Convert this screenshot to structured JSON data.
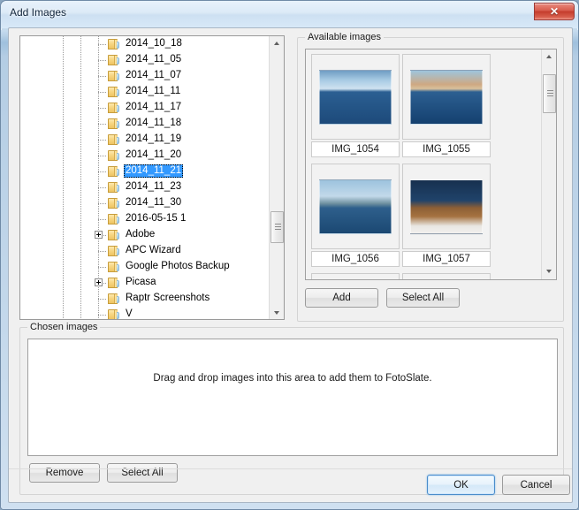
{
  "window": {
    "title": "Add Images",
    "close_label": "✕",
    "close_icon": "close-icon"
  },
  "tree": {
    "items": [
      {
        "label": "2014_10_18",
        "expandable": false,
        "selected": false,
        "partial": false
      },
      {
        "label": "2014_11_05",
        "expandable": false,
        "selected": false,
        "partial": false
      },
      {
        "label": "2014_11_07",
        "expandable": false,
        "selected": false,
        "partial": false
      },
      {
        "label": "2014_11_11",
        "expandable": false,
        "selected": false,
        "partial": false
      },
      {
        "label": "2014_11_17",
        "expandable": false,
        "selected": false,
        "partial": false
      },
      {
        "label": "2014_11_18",
        "expandable": false,
        "selected": false,
        "partial": false
      },
      {
        "label": "2014_11_19",
        "expandable": false,
        "selected": false,
        "partial": false
      },
      {
        "label": "2014_11_20",
        "expandable": false,
        "selected": false,
        "partial": false
      },
      {
        "label": "2014_11_21",
        "expandable": false,
        "selected": true,
        "partial": false
      },
      {
        "label": "2014_11_23",
        "expandable": false,
        "selected": false,
        "partial": false
      },
      {
        "label": "2014_11_30",
        "expandable": false,
        "selected": false,
        "partial": false
      },
      {
        "label": "2016-05-15 1",
        "expandable": false,
        "selected": false,
        "partial": false
      },
      {
        "label": "Adobe",
        "expandable": true,
        "selected": false,
        "partial": false
      },
      {
        "label": "APC Wizard",
        "expandable": false,
        "selected": false,
        "partial": false
      },
      {
        "label": "Google Photos Backup",
        "expandable": false,
        "selected": false,
        "partial": false
      },
      {
        "label": "Picasa",
        "expandable": true,
        "selected": false,
        "partial": false
      },
      {
        "label": "Raptr Screenshots",
        "expandable": false,
        "selected": false,
        "partial": false
      },
      {
        "label": "V",
        "expandable": false,
        "selected": false,
        "partial": true
      }
    ],
    "scroll_thumb_top_pct": 72
  },
  "available": {
    "legend": "Available images",
    "thumbnails": [
      {
        "name": "IMG_1054",
        "art": "ph-1054"
      },
      {
        "name": "IMG_1055",
        "art": "ph-1055"
      },
      {
        "name": "IMG_1056",
        "art": "ph-1056"
      },
      {
        "name": "IMG_1057",
        "art": "ph-1057"
      }
    ],
    "add_label": "Add",
    "select_all_label": "Select All",
    "scroll_thumb_top_pct": 6
  },
  "chosen": {
    "legend": "Chosen images",
    "hint": "Drag and drop images into this area to add them to FotoSlate.",
    "remove_label": "Remove",
    "select_all_label": "Select All"
  },
  "footer": {
    "ok_label": "OK",
    "cancel_label": "Cancel"
  },
  "colors": {
    "selection_blue": "#3399ff",
    "close_red": "#c43c2c",
    "default_button_border": "#4b8dcb"
  }
}
